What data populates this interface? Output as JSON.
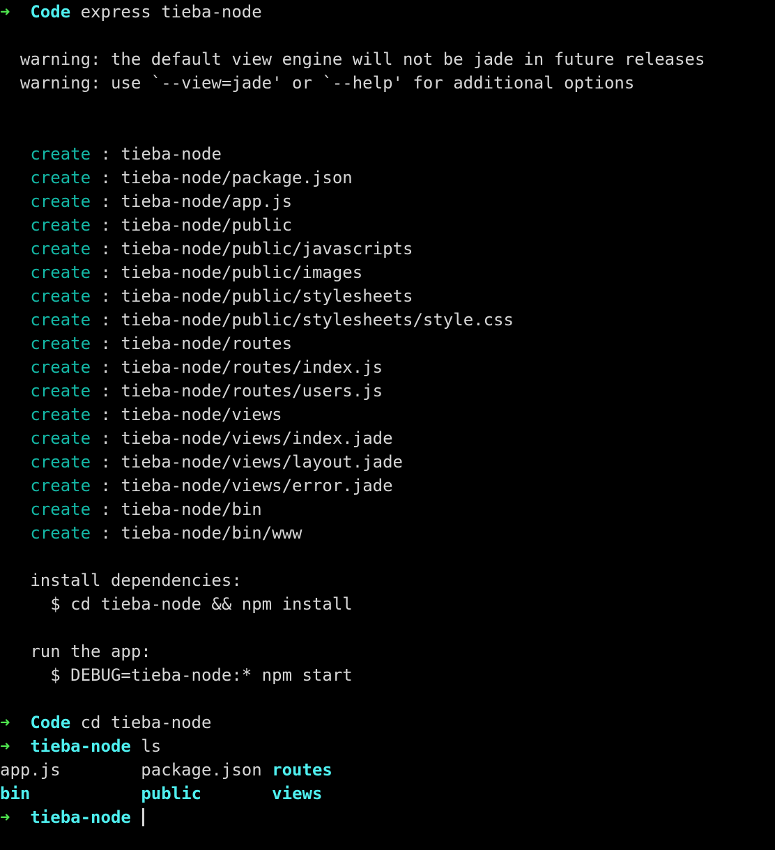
{
  "terminal": {
    "background_color": "#000000",
    "foreground_color": "#d6d6d6",
    "prompt_arrow_color": "#4ee44e",
    "prompt_context_color": "#4ff0f0",
    "create_label_color": "#14b8a6",
    "directory_color": "#4ff0f0",
    "prompt_arrow_glyph": "➜"
  },
  "prompt_1": {
    "arrow": "➜",
    "context": "Code",
    "command": "express tieba-node"
  },
  "warnings": [
    "  warning: the default view engine will not be jade in future releases",
    "  warning: use `--view=jade' or `--help' for additional options"
  ],
  "create_lines": [
    {
      "label": "create",
      "sep": " : ",
      "path": "tieba-node"
    },
    {
      "label": "create",
      "sep": " : ",
      "path": "tieba-node/package.json"
    },
    {
      "label": "create",
      "sep": " : ",
      "path": "tieba-node/app.js"
    },
    {
      "label": "create",
      "sep": " : ",
      "path": "tieba-node/public"
    },
    {
      "label": "create",
      "sep": " : ",
      "path": "tieba-node/public/javascripts"
    },
    {
      "label": "create",
      "sep": " : ",
      "path": "tieba-node/public/images"
    },
    {
      "label": "create",
      "sep": " : ",
      "path": "tieba-node/public/stylesheets"
    },
    {
      "label": "create",
      "sep": " : ",
      "path": "tieba-node/public/stylesheets/style.css"
    },
    {
      "label": "create",
      "sep": " : ",
      "path": "tieba-node/routes"
    },
    {
      "label": "create",
      "sep": " : ",
      "path": "tieba-node/routes/index.js"
    },
    {
      "label": "create",
      "sep": " : ",
      "path": "tieba-node/routes/users.js"
    },
    {
      "label": "create",
      "sep": " : ",
      "path": "tieba-node/views"
    },
    {
      "label": "create",
      "sep": " : ",
      "path": "tieba-node/views/index.jade"
    },
    {
      "label": "create",
      "sep": " : ",
      "path": "tieba-node/views/layout.jade"
    },
    {
      "label": "create",
      "sep": " : ",
      "path": "tieba-node/views/error.jade"
    },
    {
      "label": "create",
      "sep": " : ",
      "path": "tieba-node/bin"
    },
    {
      "label": "create",
      "sep": " : ",
      "path": "tieba-node/bin/www"
    }
  ],
  "install_section": {
    "heading": "   install dependencies:",
    "command": "     $ cd tieba-node && npm install"
  },
  "run_section": {
    "heading": "   run the app:",
    "command": "     $ DEBUG=tieba-node:* npm start"
  },
  "prompt_2": {
    "arrow": "➜",
    "context": "Code",
    "command": "cd tieba-node"
  },
  "prompt_3": {
    "arrow": "➜",
    "context": "tieba-node",
    "command": "ls"
  },
  "ls_output": {
    "row1": {
      "col1": "app.js",
      "col1_pad": "        ",
      "col2": "package.json",
      "col2_pad": " ",
      "col3": "routes"
    },
    "row2": {
      "col1": "bin",
      "col1_pad": "           ",
      "col2": "public",
      "col2_pad": "       ",
      "col3": "views"
    }
  },
  "prompt_4": {
    "arrow": "➜",
    "context": "tieba-node",
    "command": ""
  }
}
